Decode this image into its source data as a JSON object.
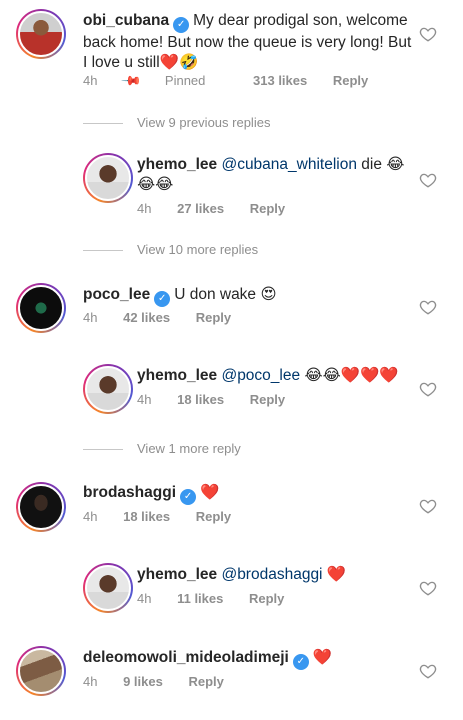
{
  "comments": [
    {
      "username": "obi_cubana",
      "verified": true,
      "text": "My dear prodigal son, welcome back home! But now the queue is very long! But I love u still",
      "emoji": "❤️🤣",
      "time": "4h",
      "pinned": "Pinned",
      "likes": "313 likes",
      "reply": "Reply"
    },
    {
      "username": "yhemo_lee",
      "mention": "@cubana_whitelion",
      "text": "die 😂😂😂",
      "time": "4h",
      "likes": "27 likes",
      "reply": "Reply"
    },
    {
      "username": "poco_lee",
      "verified": true,
      "text": "U don wake 😍",
      "time": "4h",
      "likes": "42 likes",
      "reply": "Reply"
    },
    {
      "username": "yhemo_lee",
      "mention": "@poco_lee",
      "text": "😂😂❤️❤️❤️",
      "time": "4h",
      "likes": "18 likes",
      "reply": "Reply"
    },
    {
      "username": "brodashaggi",
      "verified": true,
      "text": "❤️",
      "time": "4h",
      "likes": "18 likes",
      "reply": "Reply"
    },
    {
      "username": "yhemo_lee",
      "mention": "@brodashaggi",
      "text": "❤️",
      "time": "4h",
      "likes": "11 likes",
      "reply": "Reply"
    },
    {
      "username": "deleomowoli_mideoladimeji",
      "verified": true,
      "text": "❤️",
      "time": "4h",
      "likes": "9 likes",
      "reply": "Reply"
    }
  ],
  "view_more": [
    "View 9 previous replies",
    "View 10 more replies",
    "View 1 more reply"
  ],
  "icons": {
    "like": "heart-outline-icon",
    "pin": "pin-icon",
    "verified": "verified-badge-icon"
  },
  "colors": {
    "text": "#262626",
    "secondary": "#8e8e8e",
    "verified": "#3897f0",
    "mention": "#00376b"
  }
}
